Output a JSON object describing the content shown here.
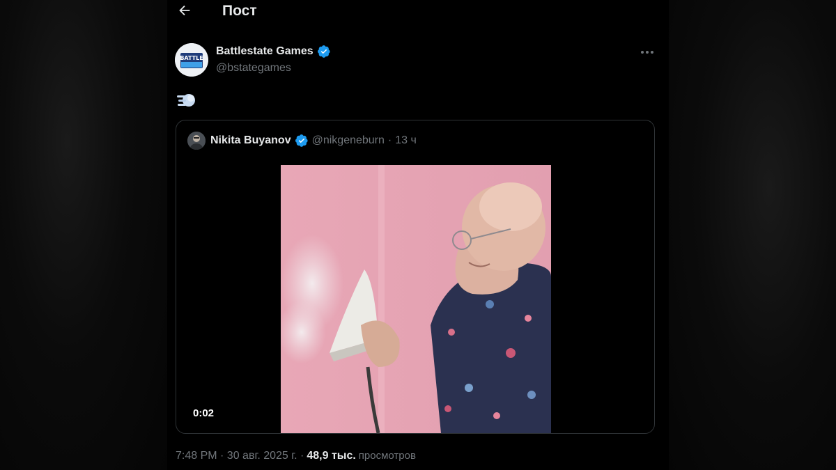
{
  "header": {
    "back_icon": "arrow-left-icon",
    "title": "Пост"
  },
  "post": {
    "author": {
      "name": "Battlestate Games",
      "handle": "@bstategames",
      "verified": true,
      "avatar_text": "BATTLE"
    },
    "more_icon": "ellipsis-icon",
    "text_emoji": "dashing-away-emoji",
    "quoted": {
      "author_name": "Nikita Buyanov",
      "verified": true,
      "handle": "@nikgeneburn",
      "separator": "·",
      "time_ago": "13 ч",
      "video": {
        "duration": "0:02",
        "description_icon": "video-thumbnail"
      }
    },
    "timestamp": "7:48 PM · 30 авг. 2025 г. ·",
    "views_count": "48,9 тыс.",
    "views_label": "просмотров"
  },
  "colors": {
    "background": "#000000",
    "text_primary": "#e7e9ea",
    "text_secondary": "#71767b",
    "verified_blue": "#1d9bf0",
    "border": "#2f3336"
  }
}
